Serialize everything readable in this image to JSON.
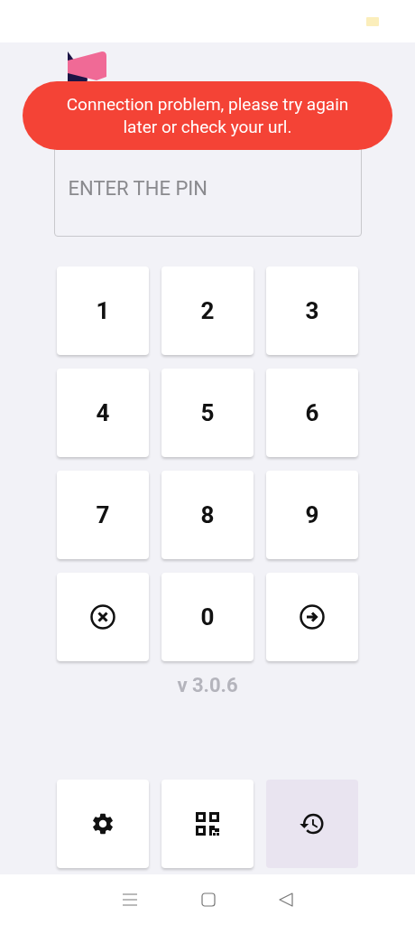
{
  "toast": {
    "message": "Connection problem, please try again later or check your url."
  },
  "pin_field": {
    "placeholder": "ENTER THE PIN"
  },
  "keypad": [
    {
      "kind": "digit",
      "label": "1"
    },
    {
      "kind": "digit",
      "label": "2"
    },
    {
      "kind": "digit",
      "label": "3"
    },
    {
      "kind": "digit",
      "label": "4"
    },
    {
      "kind": "digit",
      "label": "5"
    },
    {
      "kind": "digit",
      "label": "6"
    },
    {
      "kind": "digit",
      "label": "7"
    },
    {
      "kind": "digit",
      "label": "8"
    },
    {
      "kind": "digit",
      "label": "9"
    },
    {
      "kind": "clear"
    },
    {
      "kind": "digit",
      "label": "0"
    },
    {
      "kind": "enter"
    }
  ],
  "version": "v 3.0.6",
  "tools": [
    {
      "kind": "settings",
      "highlighted": false
    },
    {
      "kind": "qr",
      "highlighted": false
    },
    {
      "kind": "history",
      "highlighted": true
    }
  ]
}
